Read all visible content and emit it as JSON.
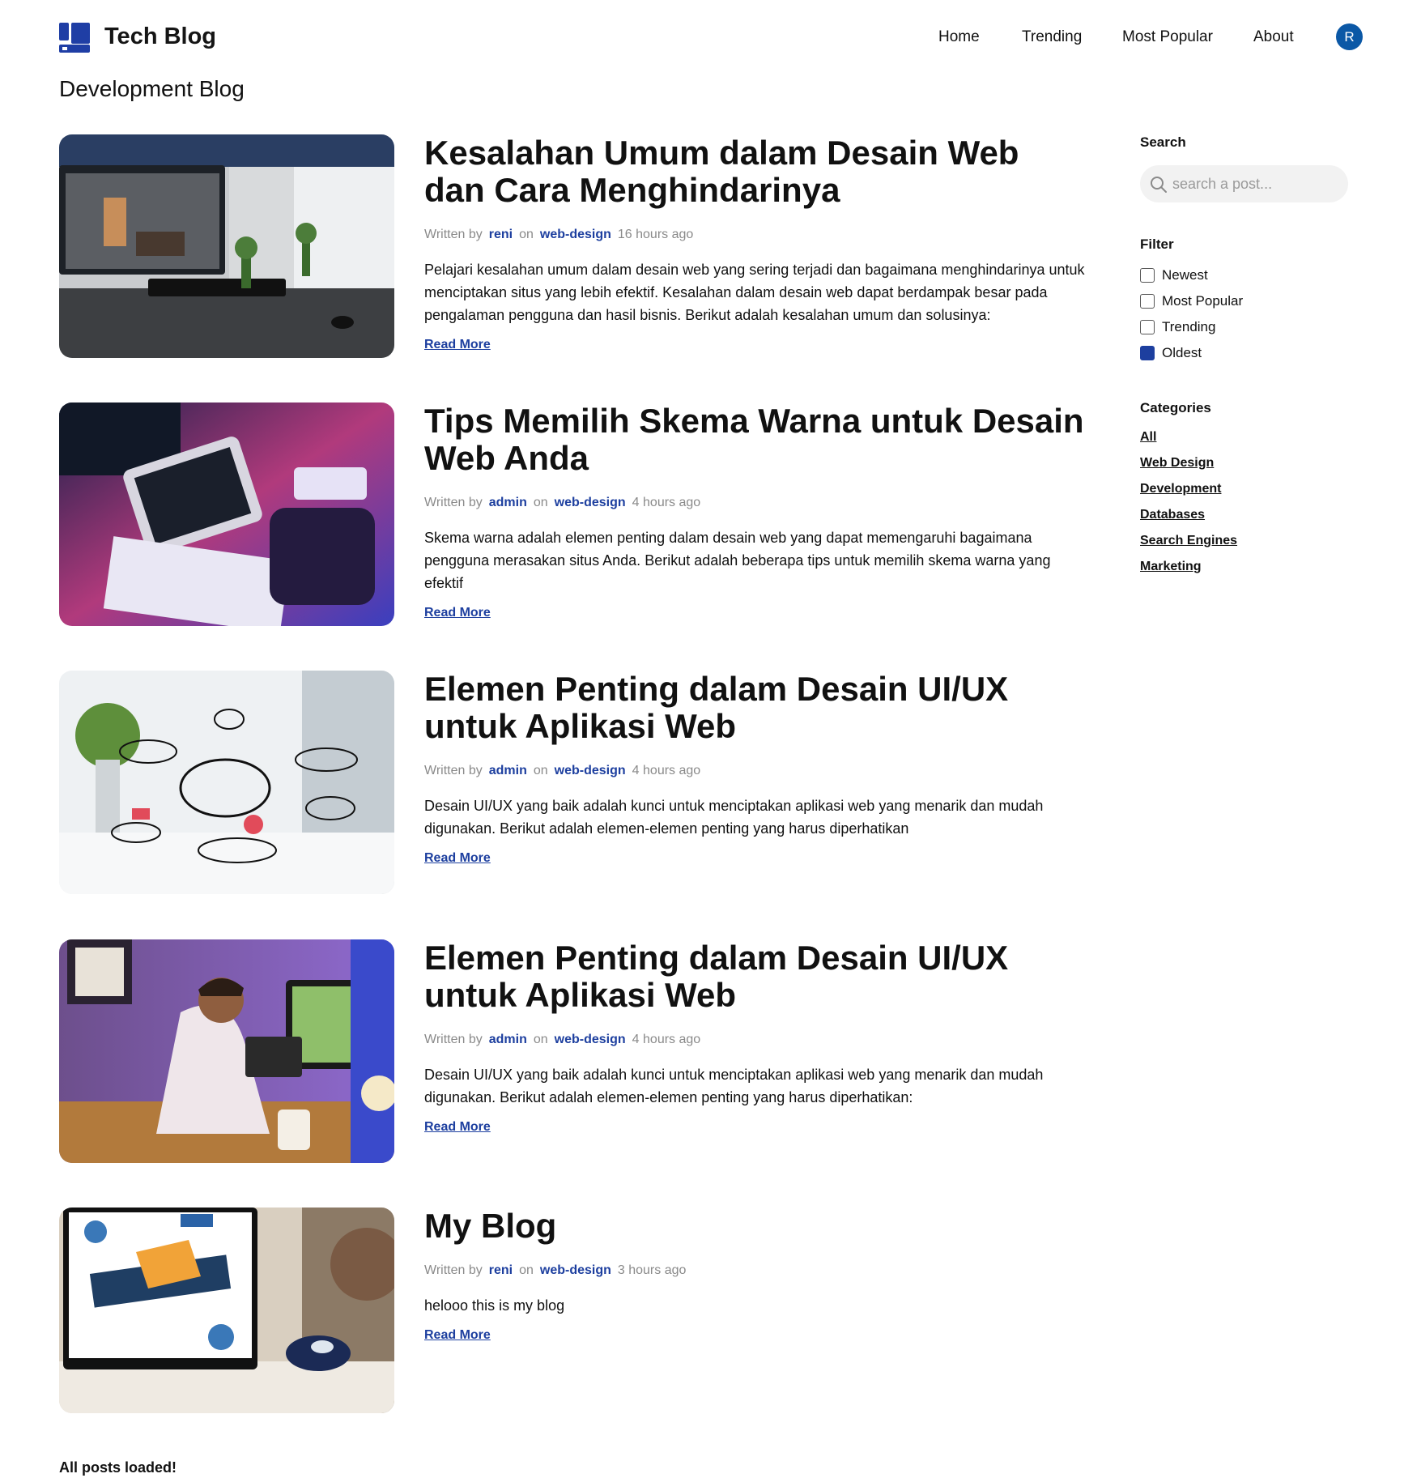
{
  "brand": {
    "name": "Tech Blog",
    "logo_icon": "tech-blog-logo-icon"
  },
  "nav": {
    "home": "Home",
    "trending": "Trending",
    "most_popular": "Most Popular",
    "about": "About",
    "avatar_initial": "R"
  },
  "page_title": "Development Blog",
  "meta_labels": {
    "written_by": "Written by",
    "on": "on",
    "read_more": "Read More"
  },
  "posts": [
    {
      "title": "Kesalahan Umum dalam Desain Web dan Cara Menghindarinya",
      "author": "reni",
      "category": "web-design",
      "time": "16 hours ago",
      "excerpt": "Pelajari kesalahan umum dalam desain web yang sering terjadi dan bagaimana menghindarinya untuk menciptakan situs yang lebih efektif. Kesalahan dalam desain web dapat berdampak besar pada pengalaman pengguna dan hasil bisnis. Berikut adalah kesalahan umum dan solusinya:"
    },
    {
      "title": "Tips Memilih Skema Warna untuk Desain Web Anda",
      "author": "admin",
      "category": "web-design",
      "time": "4 hours ago",
      "excerpt": "Skema warna adalah elemen penting dalam desain web yang dapat memengaruhi bagaimana pengguna merasakan situs Anda. Berikut adalah beberapa tips untuk memilih skema warna yang efektif"
    },
    {
      "title": "Elemen Penting dalam Desain UI/UX untuk Aplikasi Web",
      "author": "admin",
      "category": "web-design",
      "time": "4 hours ago",
      "excerpt": "Desain UI/UX yang baik adalah kunci untuk menciptakan aplikasi web yang menarik dan mudah digunakan. Berikut adalah elemen-elemen penting yang harus diperhatikan"
    },
    {
      "title": "Elemen Penting dalam Desain UI/UX untuk Aplikasi Web",
      "author": "admin",
      "category": "web-design",
      "time": "4 hours ago",
      "excerpt": "Desain UI/UX yang baik adalah kunci untuk menciptakan aplikasi web yang menarik dan mudah digunakan. Berikut adalah elemen-elemen penting yang harus diperhatikan:"
    },
    {
      "title": "My Blog",
      "author": "reni",
      "category": "web-design",
      "time": "3 hours ago",
      "excerpt": "helooo this is my blog"
    }
  ],
  "sidebar": {
    "search_label": "Search",
    "search_placeholder": "search a post...",
    "search_icon": "search-icon",
    "filter_label": "Filter",
    "filters": [
      {
        "label": "Newest",
        "checked": false
      },
      {
        "label": "Most Popular",
        "checked": false
      },
      {
        "label": "Trending",
        "checked": false
      },
      {
        "label": "Oldest",
        "checked": true
      }
    ],
    "categories_label": "Categories",
    "categories": [
      "All",
      "Web Design",
      "Development",
      "Databases",
      "Search Engines",
      "Marketing"
    ]
  },
  "footer_note": "All posts loaded!",
  "colors": {
    "accent": "#1d3f9f",
    "avatar_bg": "#0b58a6",
    "muted": "#8a8a8a"
  }
}
